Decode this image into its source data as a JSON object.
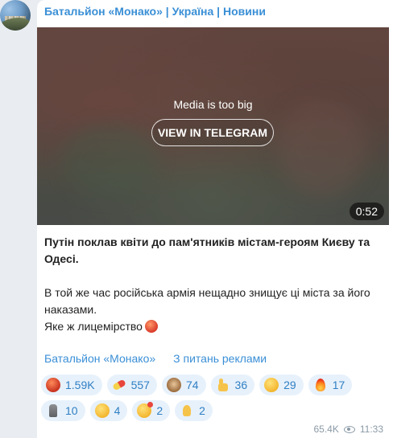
{
  "channel": {
    "title": "Батальйон «Монако» | Україна | Новини"
  },
  "media": {
    "message": "Media is too big",
    "button_label": "VIEW IN TELEGRAM",
    "duration": "0:52"
  },
  "post": {
    "headline": "Путін поклав квіти до пам'ятників містам-героям Києву та Одесі.",
    "paragraph_line1": "В той же час російська армія нещадно знищує ці міста за його наказами.",
    "paragraph_line2": "Яке ж лицемірство"
  },
  "links": {
    "channel_link": "Батальйон «Монако»",
    "ads_link": "З питань реклами"
  },
  "reactions": [
    {
      "icon": "angry-face-icon",
      "count": "1.59K"
    },
    {
      "icon": "pill-icon",
      "count": "557"
    },
    {
      "icon": "see-no-evil-monkey-icon",
      "count": "74"
    },
    {
      "icon": "thumbs-up-icon",
      "count": "36"
    },
    {
      "icon": "smirk-face-icon",
      "count": "29"
    },
    {
      "icon": "fire-icon",
      "count": "17"
    },
    {
      "icon": "moai-icon",
      "count": "10"
    },
    {
      "icon": "thinking-face-icon",
      "count": "4"
    },
    {
      "icon": "smiling-face-with-hearts-icon",
      "count": "2"
    },
    {
      "icon": "folded-hands-icon",
      "count": "2"
    }
  ],
  "meta": {
    "views": "65.4K",
    "time": "11:33"
  },
  "colors": {
    "accent": "#3a8fd6",
    "background": "#e9edf1",
    "reaction_bg": "#e7f1fb"
  }
}
